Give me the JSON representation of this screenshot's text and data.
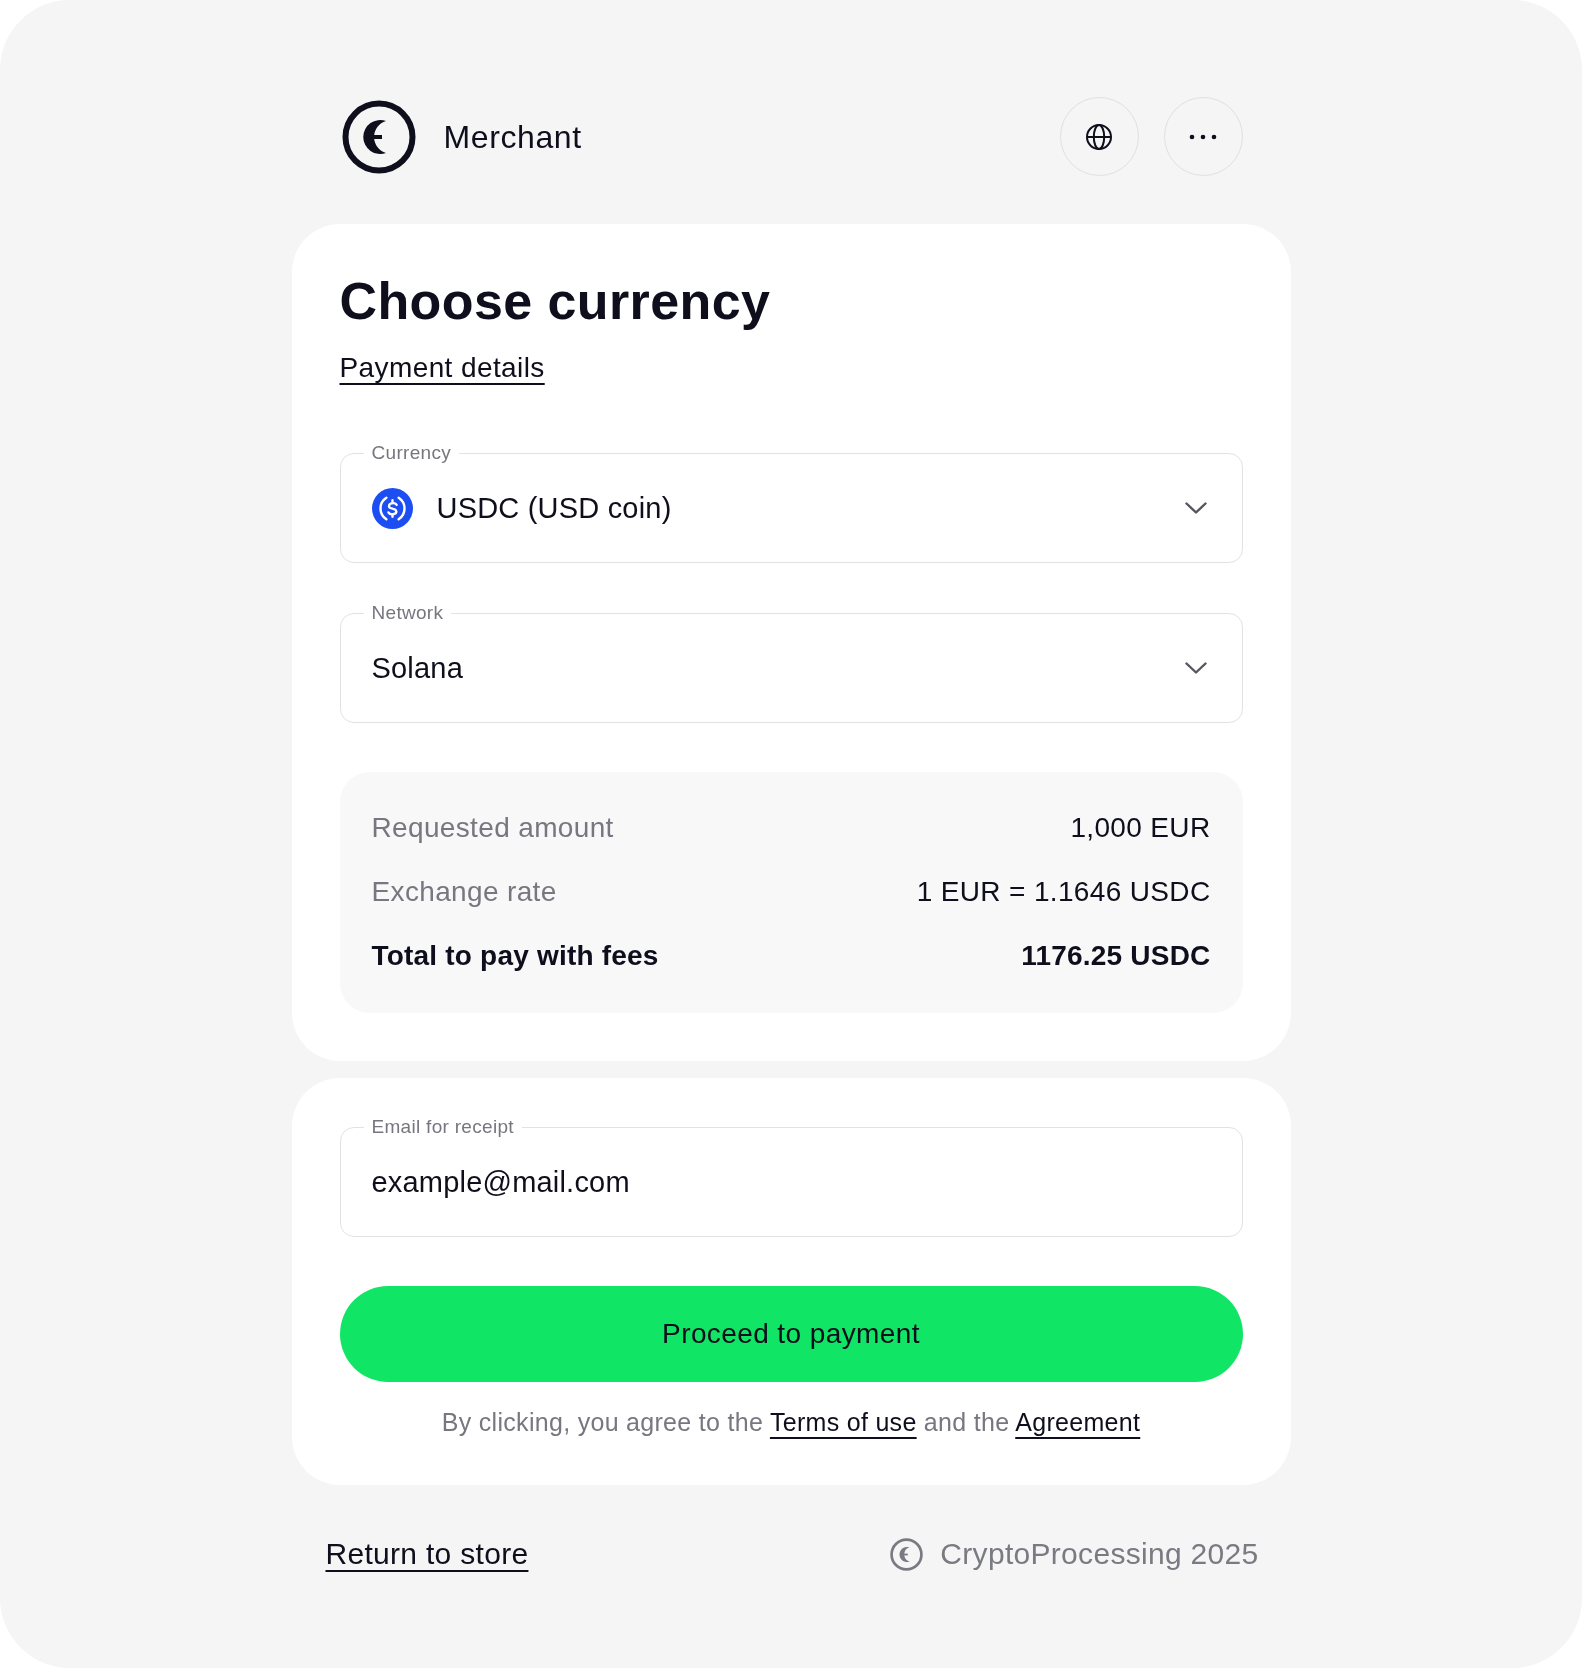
{
  "header": {
    "merchant_name": "Merchant"
  },
  "currency_card": {
    "title": "Choose currency",
    "details_link": "Payment details",
    "fields": [
      {
        "kind": "coin-select",
        "label": "Currency",
        "value": "USDC (USD coin)"
      },
      {
        "kind": "select",
        "label": "Network",
        "value": "Solana"
      }
    ],
    "summary": [
      {
        "label": "Requested amount",
        "value": "1,000 EUR",
        "emphasized": false
      },
      {
        "label": "Exchange rate",
        "value": "1 EUR = 1.1646 USDC",
        "emphasized": false
      },
      {
        "label": "Total to pay with fees",
        "value": "1176.25 USDC",
        "emphasized": true
      }
    ]
  },
  "receipt_card": {
    "email_field": {
      "label": "Email for receipt",
      "value": "example@mail.com"
    },
    "submit_button": "Proceed to payment",
    "terms": [
      {
        "kind": "text",
        "text": "By clicking, you agree to the "
      },
      {
        "kind": "link",
        "text": "Terms of use"
      },
      {
        "kind": "text",
        "text": " and the "
      },
      {
        "kind": "link",
        "text": "Agreement"
      }
    ]
  },
  "footer": {
    "return_link": "Return to store",
    "copyright": "CryptoProcessing 2025"
  }
}
